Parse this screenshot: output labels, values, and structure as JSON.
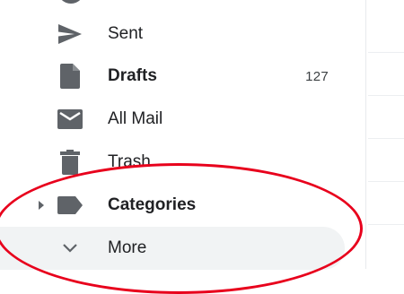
{
  "nav": {
    "items": [
      {
        "label": "Sent",
        "icon": "send-icon",
        "bold": false,
        "count": ""
      },
      {
        "label": "Drafts",
        "icon": "draft-icon",
        "bold": true,
        "count": "127"
      },
      {
        "label": "All Mail",
        "icon": "mail-icon",
        "bold": false,
        "count": ""
      },
      {
        "label": "Trash",
        "icon": "trash-icon",
        "bold": false,
        "count": ""
      },
      {
        "label": "Categories",
        "icon": "label-icon",
        "bold": true,
        "count": ""
      },
      {
        "label": "More",
        "icon": "chevron-down-icon",
        "bold": false,
        "count": ""
      }
    ]
  },
  "colors": {
    "icon": "#5f6368",
    "text": "#202124",
    "selected_bg": "#f1f3f4",
    "annotation": "#e8001c"
  }
}
